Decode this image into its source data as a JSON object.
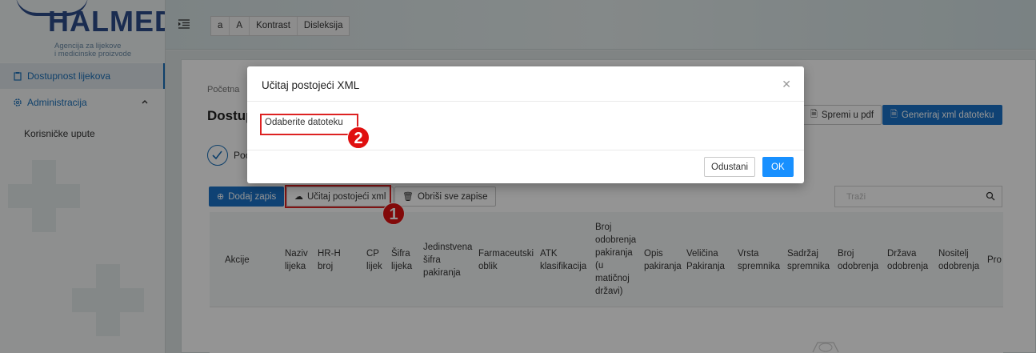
{
  "sidebar": {
    "logo_text": "HALMED",
    "logo_sub": [
      "Agencija za lijekove",
      "i medicinske proizvode"
    ],
    "items": [
      {
        "label": "Dostupnost lijekova",
        "icon": "clipboard-icon"
      },
      {
        "label": "Administracija",
        "icon": "gear-icon"
      },
      {
        "label": "Korisničke upute"
      }
    ]
  },
  "header": {
    "toolbar": [
      "a",
      "A",
      "Kontrast",
      "Disleksija"
    ]
  },
  "main": {
    "breadcrumb": "Početna",
    "title": "Dostup",
    "step_label": "Poc",
    "buttons": {
      "spremi": "Spremi u pdf",
      "generiraj": "Generiraj xml datoteku",
      "dodaj": "Dodaj zapis",
      "ucitaj": "Učitaj postojeći xml",
      "obrisi": "Obriši sve zapise"
    },
    "search_placeholder": "Traži",
    "columns": [
      "Akcije",
      "Naziv lijeka",
      "HR-H broj",
      "CP lijek",
      "Šifra lijeka",
      "Jedinstvena šifra pakiranja",
      "Farmaceutski oblik",
      "ATK klasifikacija",
      "Broj odobrenja pakiranja (u matičnoj državi)",
      "Opis pakiranja",
      "Veličina Pakiranja",
      "Vrsta spremnika",
      "Sadržaj spremnika",
      "Broj odobrenja",
      "Država odobrenja",
      "Nositelj odobrenja",
      "Pro"
    ]
  },
  "modal": {
    "title": "Učitaj postojeći XML",
    "select_file": "Odaberite datoteku",
    "cancel": "Odustani",
    "ok": "OK"
  },
  "callouts": [
    "1",
    "2"
  ],
  "colors": {
    "primary": "#1a73c8",
    "ok": "#1890ff",
    "highlight": "#dd2222"
  }
}
